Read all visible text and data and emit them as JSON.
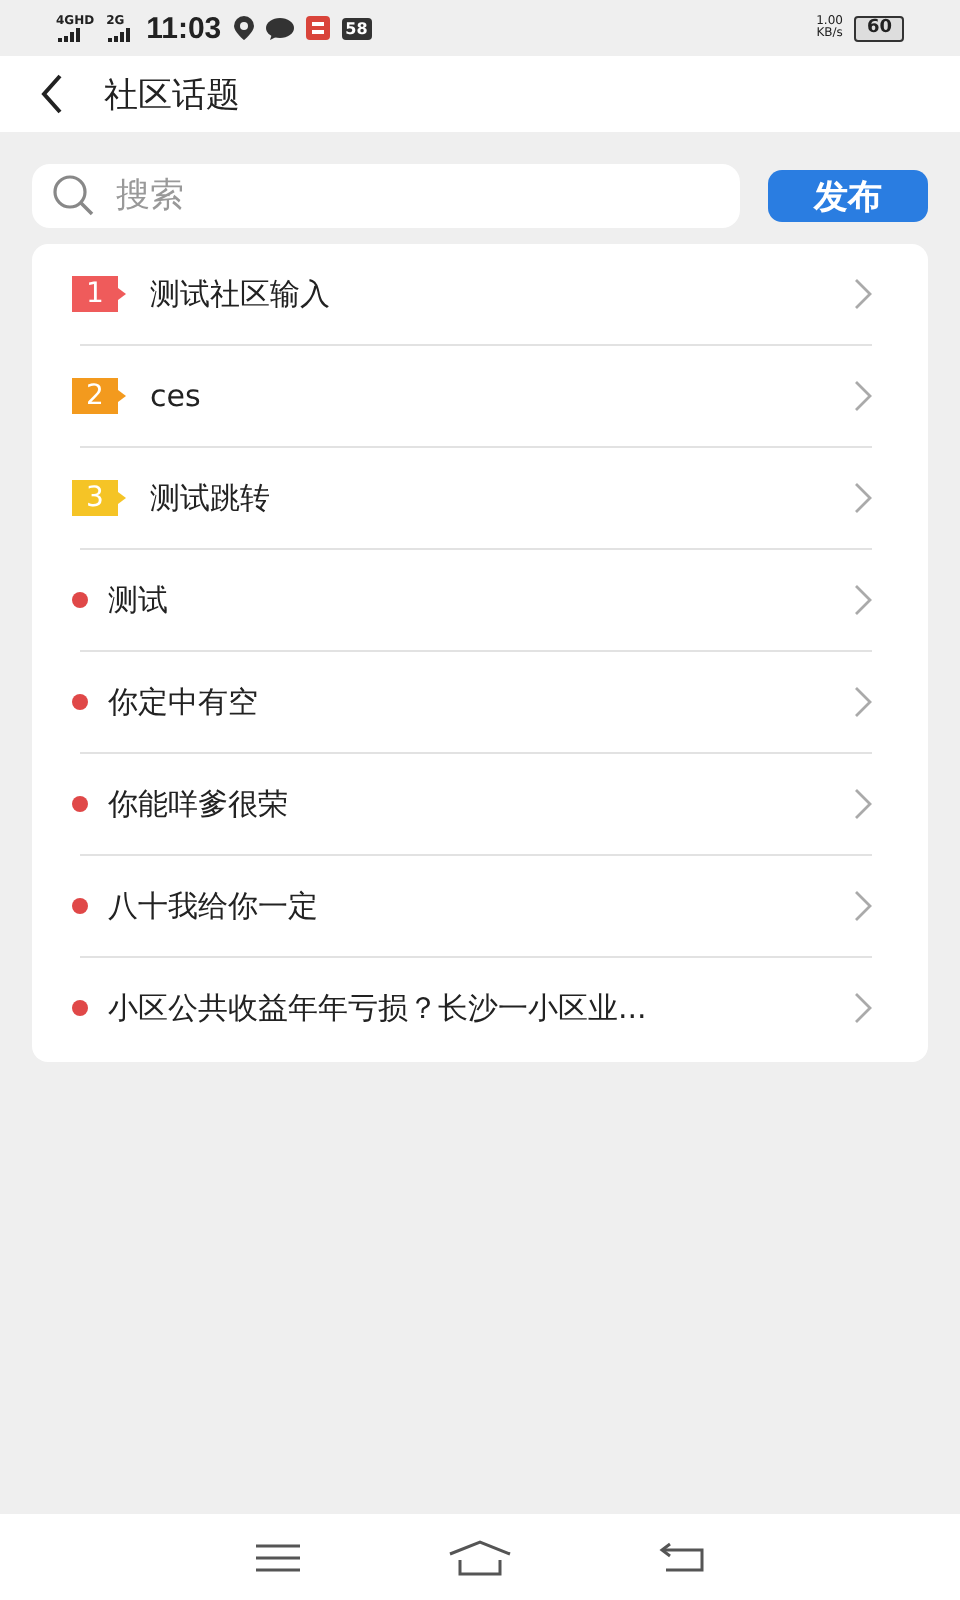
{
  "status_bar": {
    "network_1": "4GHD",
    "network_2": "2G",
    "time": "11:03",
    "notification_badge": "58",
    "speed": "1.00",
    "speed_unit": "KB/s",
    "battery": "60"
  },
  "header": {
    "title": "社区话题"
  },
  "search": {
    "placeholder": "搜索"
  },
  "publish_button": "发布",
  "topics": [
    {
      "kind": "ranked",
      "rank": "1",
      "color": "#ef5b5b",
      "title": "测试社区输入"
    },
    {
      "kind": "ranked",
      "rank": "2",
      "color": "#f39a1e",
      "title": "ces"
    },
    {
      "kind": "ranked",
      "rank": "3",
      "color": "#f5c426",
      "title": "测试跳转"
    },
    {
      "kind": "plain",
      "title": "测试"
    },
    {
      "kind": "plain",
      "title": "你定中有空"
    },
    {
      "kind": "plain",
      "title": "你能咩爹很荣"
    },
    {
      "kind": "plain",
      "title": "八十我给你一定"
    },
    {
      "kind": "plain",
      "title": "小区公共收益年年亏损？长沙一小区业..."
    }
  ]
}
